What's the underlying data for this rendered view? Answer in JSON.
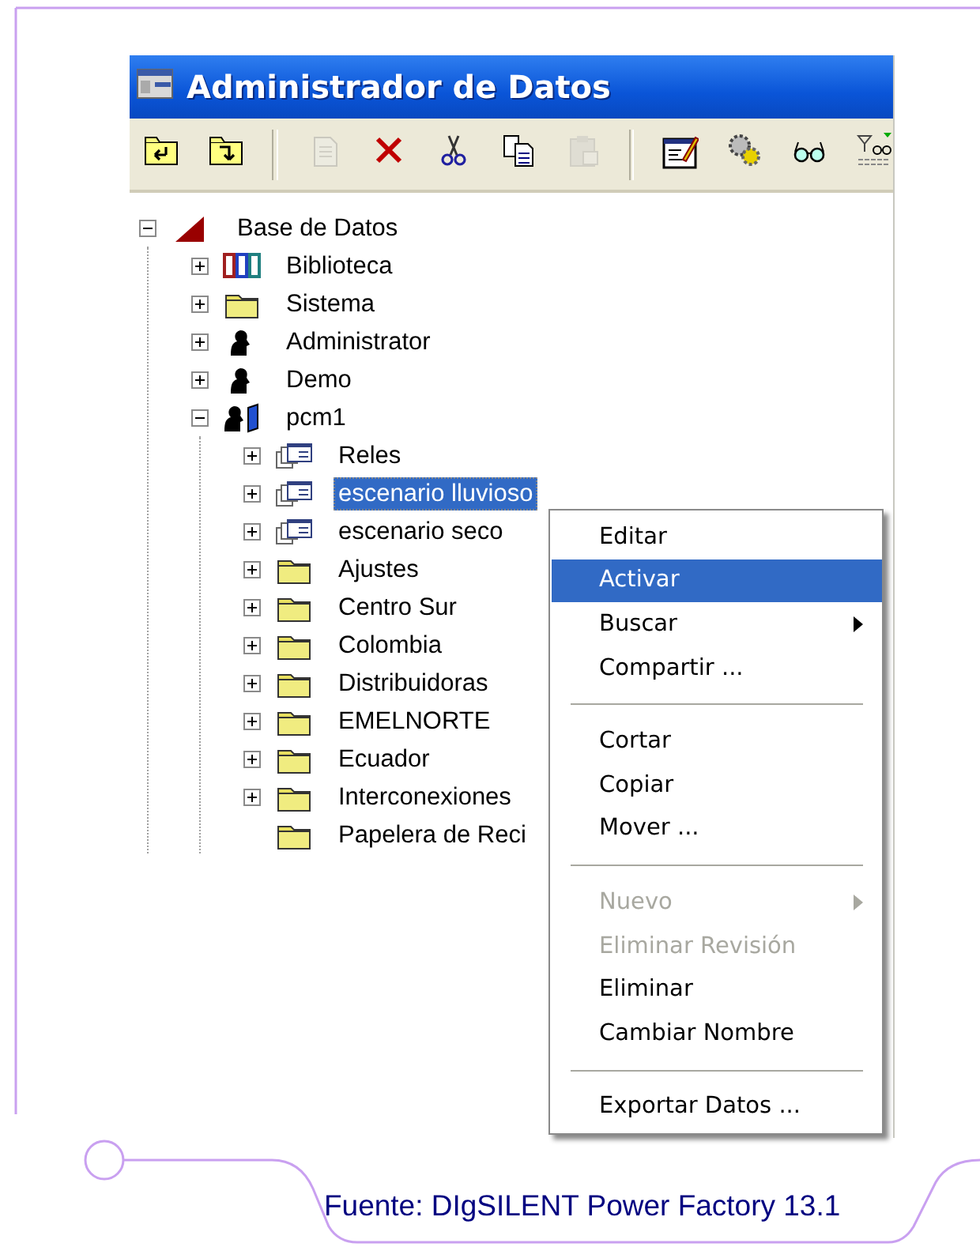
{
  "window": {
    "title": "Administrador de Datos"
  },
  "toolbar": [
    {
      "kind": "folder-up",
      "disabled": false
    },
    {
      "kind": "folder-down",
      "disabled": false
    },
    {
      "kind": "separator"
    },
    {
      "kind": "new",
      "disabled": true
    },
    {
      "kind": "delete",
      "disabled": false
    },
    {
      "kind": "cut",
      "disabled": false
    },
    {
      "kind": "copy",
      "disabled": false
    },
    {
      "kind": "paste",
      "disabled": true
    },
    {
      "kind": "separator"
    },
    {
      "kind": "edit",
      "disabled": false
    },
    {
      "kind": "gears",
      "disabled": false
    },
    {
      "kind": "glasses",
      "disabled": false
    },
    {
      "kind": "filter",
      "disabled": false
    }
  ],
  "tree": [
    {
      "label": "Base de Datos",
      "kind": "database",
      "expanded": true,
      "leaf": false,
      "selected": false,
      "children": [
        {
          "label": "Biblioteca",
          "kind": "library",
          "expanded": false,
          "leaf": false,
          "selected": false
        },
        {
          "label": "Sistema",
          "kind": "folder",
          "expanded": false,
          "leaf": false,
          "selected": false
        },
        {
          "label": "Administrator",
          "kind": "user",
          "expanded": false,
          "leaf": false,
          "selected": false
        },
        {
          "label": "Demo",
          "kind": "user",
          "expanded": false,
          "leaf": false,
          "selected": false
        },
        {
          "label": "pcm1",
          "kind": "user-project",
          "expanded": true,
          "leaf": false,
          "selected": false,
          "children": [
            {
              "label": "Reles",
              "kind": "scenario",
              "expanded": false,
              "leaf": false,
              "selected": false
            },
            {
              "label": "escenario lluvioso",
              "kind": "scenario",
              "expanded": false,
              "leaf": false,
              "selected": true
            },
            {
              "label": "escenario seco",
              "kind": "scenario",
              "expanded": false,
              "leaf": false,
              "selected": false
            },
            {
              "label": "Ajustes",
              "kind": "folder",
              "expanded": false,
              "leaf": false,
              "selected": false
            },
            {
              "label": "Centro Sur",
              "kind": "folder",
              "expanded": false,
              "leaf": false,
              "selected": false
            },
            {
              "label": "Colombia",
              "kind": "folder",
              "expanded": false,
              "leaf": false,
              "selected": false
            },
            {
              "label": "Distribuidoras",
              "kind": "folder",
              "expanded": false,
              "leaf": false,
              "selected": false
            },
            {
              "label": "EMELNORTE",
              "kind": "folder",
              "expanded": false,
              "leaf": false,
              "selected": false
            },
            {
              "label": "Ecuador",
              "kind": "folder",
              "expanded": false,
              "leaf": false,
              "selected": false
            },
            {
              "label": "Interconexiones",
              "kind": "folder",
              "expanded": false,
              "leaf": false,
              "selected": false
            },
            {
              "label": "Papelera de Reci",
              "kind": "folder",
              "leaf": true,
              "selected": false
            }
          ]
        }
      ]
    }
  ],
  "context_menu": [
    {
      "kind": "item",
      "label": "Editar",
      "selected": false,
      "disabled": false,
      "submenu": false
    },
    {
      "kind": "item",
      "label": "Activar",
      "selected": true,
      "disabled": false,
      "submenu": false
    },
    {
      "kind": "item",
      "label": "Buscar",
      "selected": false,
      "disabled": false,
      "submenu": true
    },
    {
      "kind": "item",
      "label": "Compartir ...",
      "selected": false,
      "disabled": false,
      "submenu": false
    },
    {
      "kind": "separator"
    },
    {
      "kind": "item",
      "label": "Cortar",
      "selected": false,
      "disabled": false,
      "submenu": false
    },
    {
      "kind": "item",
      "label": "Copiar",
      "selected": false,
      "disabled": false,
      "submenu": false
    },
    {
      "kind": "item",
      "label": "Mover ...",
      "selected": false,
      "disabled": false,
      "submenu": false
    },
    {
      "kind": "separator"
    },
    {
      "kind": "item",
      "label": "Nuevo",
      "selected": false,
      "disabled": true,
      "submenu": true
    },
    {
      "kind": "item",
      "label": "Eliminar Revisión",
      "selected": false,
      "disabled": true,
      "submenu": false
    },
    {
      "kind": "item",
      "label": "Eliminar",
      "selected": false,
      "disabled": false,
      "submenu": false
    },
    {
      "kind": "item",
      "label": "Cambiar Nombre",
      "selected": false,
      "disabled": false,
      "submenu": false
    },
    {
      "kind": "separator"
    },
    {
      "kind": "item",
      "label": "Exportar Datos ...",
      "selected": false,
      "disabled": false,
      "submenu": false
    }
  ],
  "caption": "Fuente: DIgSILENT Power Factory 13.1"
}
